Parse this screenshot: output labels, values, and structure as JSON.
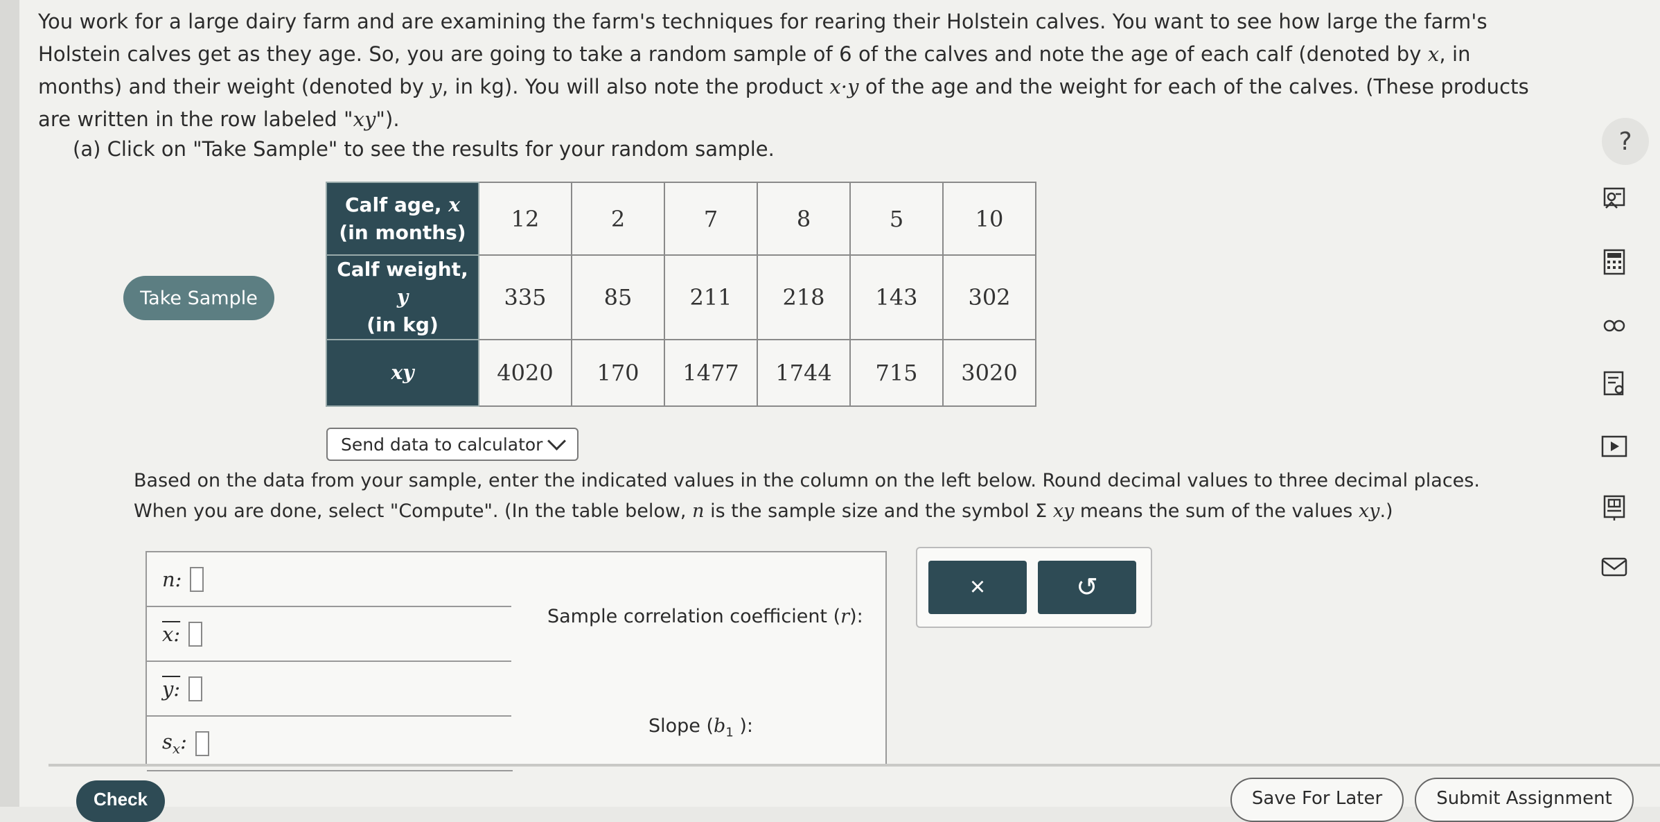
{
  "question": {
    "intro": [
      [
        "text",
        "You work for a large dairy farm and are examining the farm's techniques for rearing their Holstein calves. You want to see how large the farm's Holstein calves get as they age. So, you are going to take a random sample of 6 of the calves and note the age of each calf (denoted by "
      ],
      [
        "math",
        "x"
      ],
      [
        "text",
        ", in months) and their weight (denoted by "
      ],
      [
        "math",
        "y"
      ],
      [
        "text",
        ", in kg). You will also note the product "
      ],
      [
        "math",
        "x·y"
      ],
      [
        "text",
        " of the age and the weight for each of the calves. (These products are written in the row labeled \""
      ],
      [
        "math",
        "xy"
      ],
      [
        "text",
        "\")."
      ]
    ],
    "part_a": "(a) Click on \"Take Sample\" to see the results for your random sample.",
    "take_sample_label": "Take Sample",
    "send_data_label": "Send data to calculator",
    "instructions": [
      [
        "text",
        "Based on the data from your sample, enter the indicated values in the column on the left below. Round decimal values to three decimal places. When you are done, select \"Compute\". (In the table below, "
      ],
      [
        "math",
        "n"
      ],
      [
        "text",
        " is the sample size and the symbol Σ "
      ],
      [
        "math",
        "xy"
      ],
      [
        "text",
        " means the sum of the values "
      ],
      [
        "math",
        "xy"
      ],
      [
        "text",
        ".)"
      ]
    ]
  },
  "sample_table": {
    "row_headers": [
      {
        "label": "Calf age, ",
        "var": "x",
        "sub": "(in months)"
      },
      {
        "label": "Calf weight, ",
        "var": "y",
        "sub": "(in kg)"
      },
      {
        "label": "",
        "var": "xy",
        "sub": ""
      }
    ],
    "rows": [
      [
        "12",
        "2",
        "7",
        "8",
        "5",
        "10"
      ],
      [
        "335",
        "85",
        "211",
        "218",
        "143",
        "302"
      ],
      [
        "4020",
        "170",
        "1477",
        "1744",
        "715",
        "3020"
      ]
    ]
  },
  "answer_table": {
    "left_labels": [
      "n:",
      "x:",
      "y:",
      "s"
    ],
    "sx_subscript": "x",
    "sx_colon": ":",
    "corr_text": "Sample correlation coefficient (",
    "corr_var": "r",
    "corr_end": "):",
    "slope_text": "Slope (",
    "slope_var": "b",
    "slope_sub": "1",
    "slope_end": " ):"
  },
  "actions": {
    "clear": "×",
    "undo": "↺"
  },
  "rail": {
    "help": "?"
  },
  "footer": {
    "check": "Check",
    "save": "Save For Later",
    "submit": "Submit Assignment"
  },
  "colors": {
    "accent": "#2e4b55",
    "take_sample": "#5c7e82",
    "background": "#f1f1ee"
  }
}
